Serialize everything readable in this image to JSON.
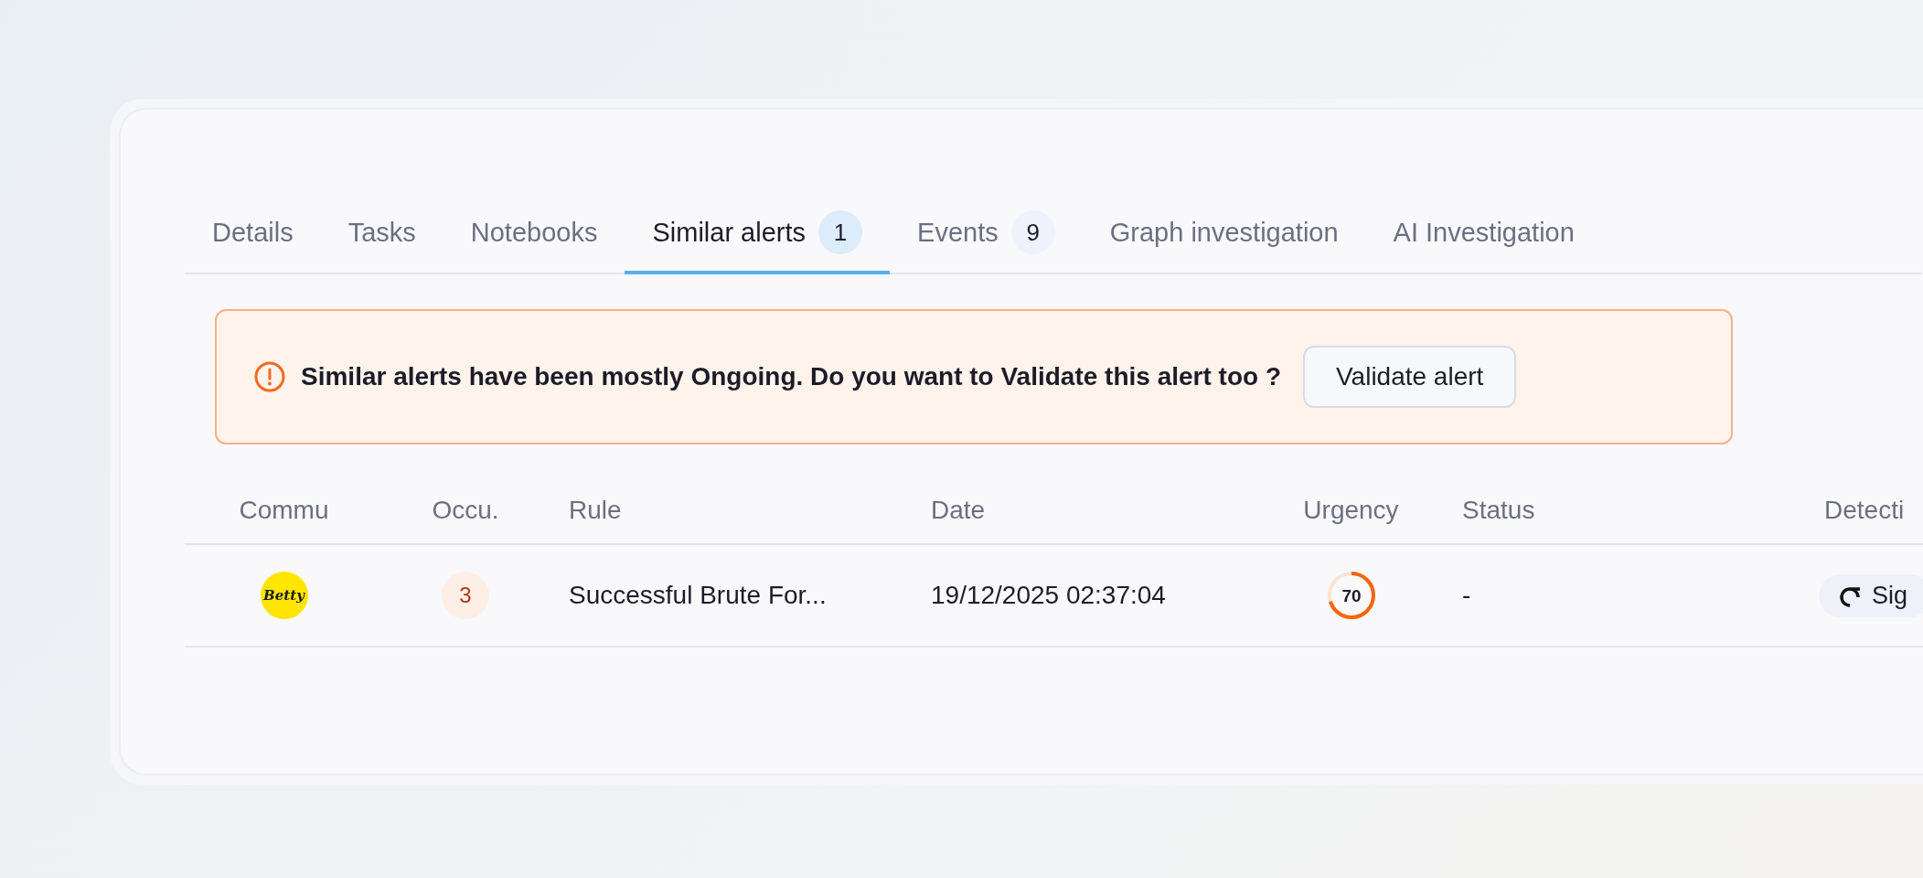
{
  "tabs": [
    {
      "label": "Details",
      "selected": false
    },
    {
      "label": "Tasks",
      "selected": false
    },
    {
      "label": "Notebooks",
      "selected": false
    },
    {
      "label": "Similar alerts",
      "count": "1",
      "selected": true
    },
    {
      "label": "Events",
      "count": "9",
      "selected": false
    },
    {
      "label": "Graph investigation",
      "selected": false
    },
    {
      "label": "AI Investigation",
      "selected": false
    }
  ],
  "banner": {
    "message": "Similar alerts have been mostly Ongoing. Do you want to Validate this alert too ?",
    "button": "Validate alert"
  },
  "table": {
    "columns": [
      "Commu",
      "Occu.",
      "Rule",
      "Date",
      "Urgency",
      "Status",
      "Detecti"
    ],
    "rows": [
      {
        "community_logo": "Betty",
        "occurrences": "3",
        "rule": "Successful Brute For...",
        "date": "19/12/2025 02:37:04",
        "urgency": {
          "value": "70",
          "level": 0.7
        },
        "status": "-",
        "detection": "Sig"
      }
    ]
  }
}
